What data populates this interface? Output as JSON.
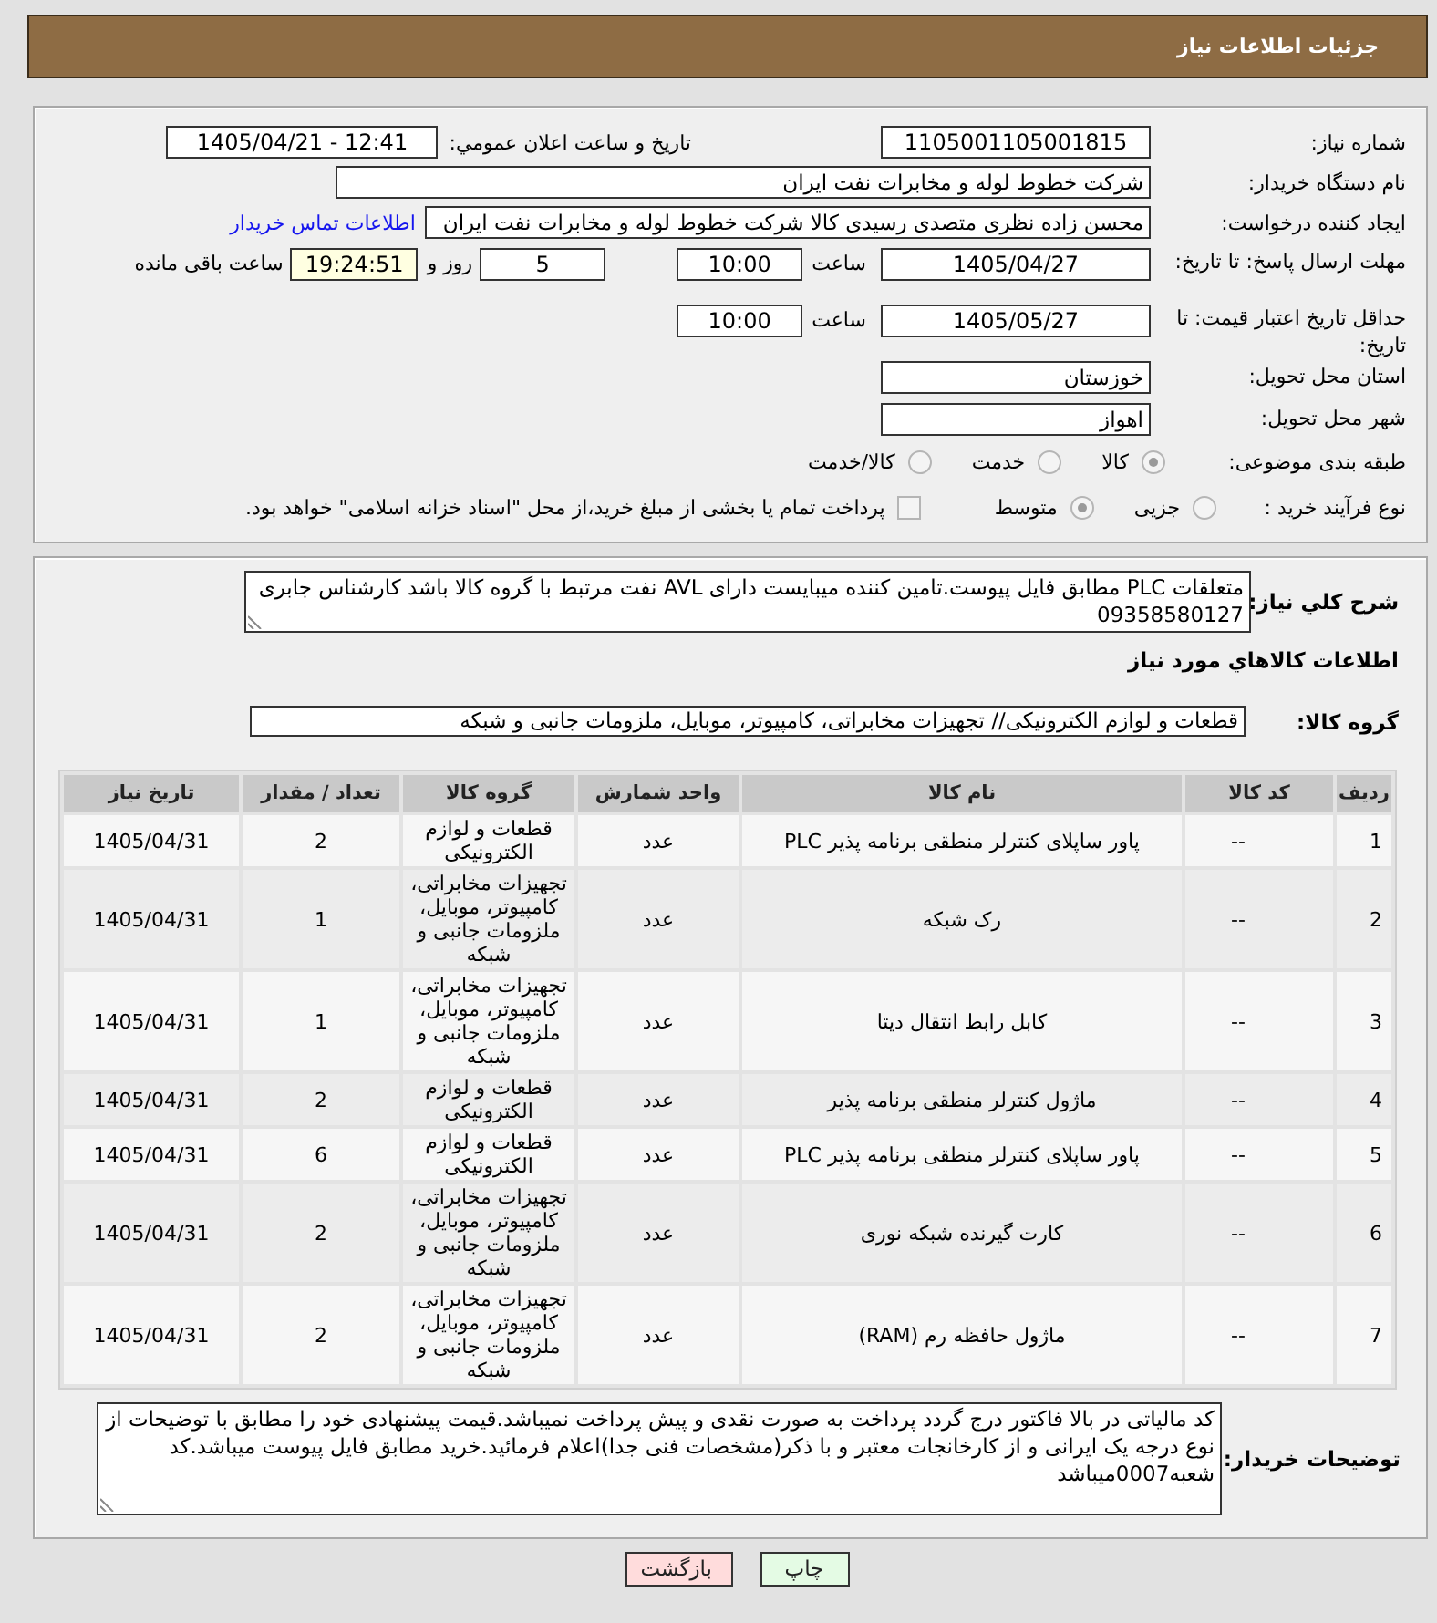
{
  "header": {
    "title": "جزئیات اطلاعات نیاز"
  },
  "details": {
    "need_number": {
      "label": "شماره نیاز:",
      "value": "1105001105001815"
    },
    "announce": {
      "label": "تاریخ و ساعت اعلان عمومي:",
      "value": "1405/04/21 - 12:41"
    },
    "buyer_org": {
      "label": "نام دستگاه خریدار:",
      "value": "شرکت خطوط لوله و مخابرات نفت ایران"
    },
    "creator": {
      "label": "ایجاد کننده درخواست:",
      "value": "محسن زاده نظری متصدی رسیدی کالا شرکت خطوط لوله و مخابرات نفت ایران",
      "link": "اطلاعات تماس خریدار"
    },
    "response_deadline": {
      "label": "مهلت ارسال پاسخ: تا تاریخ:",
      "date": "1405/04/27",
      "time_label": "ساعت",
      "time": "10:00",
      "days": "5",
      "days_label": "روز و",
      "remaining": "19:24:51",
      "remaining_label": "ساعت باقی مانده"
    },
    "price_validity": {
      "label": "حداقل تاریخ اعتبار قیمت: تا تاریخ:",
      "date": "1405/05/27",
      "time_label": "ساعت",
      "time": "10:00"
    },
    "province": {
      "label": "استان محل تحویل:",
      "value": "خوزستان"
    },
    "city": {
      "label": "شهر محل تحویل:",
      "value": "اهواز"
    },
    "category": {
      "label": "طبقه بندی موضوعی:",
      "disabled": true,
      "options": [
        {
          "label": "کالا",
          "selected": true
        },
        {
          "label": "خدمت",
          "selected": false
        },
        {
          "label": "کالا/خدمت",
          "selected": false
        }
      ]
    },
    "purchase_type": {
      "label": "نوع فرآیند خرید :",
      "disabled": true,
      "options": [
        {
          "label": "جزیی",
          "selected": false
        },
        {
          "label": "متوسط",
          "selected": true
        }
      ],
      "treasury": {
        "label": "پرداخت تمام یا بخشی از مبلغ خرید،از محل \"اسناد خزانه اسلامی\" خواهد بود.",
        "checked": false,
        "disabled": true
      }
    }
  },
  "description": {
    "label": "شرح کلي نیاز:",
    "value": "متعلقات PLC مطابق فایل پیوست.تامین کننده میبایست دارای AVL نفت مرتبط با گروه کالا باشد کارشناس جابری 09358580127"
  },
  "goods": {
    "title": "اطلاعات کالاهاي مورد نیاز",
    "group_label": "گروه کالا:",
    "group_value": "قطعات و لوازم الکترونیکی// تجهیزات مخابراتی، کامپیوتر، موبایل، ملزومات جانبی و شبکه",
    "table": {
      "columns": [
        "ردیف",
        "کد کالا",
        "نام کالا",
        "واحد شمارش",
        "گروه کالا",
        "تعداد / مقدار",
        "تاریخ نیاز"
      ],
      "rows": [
        {
          "index": "1",
          "code": "--",
          "name": "پاور ساپلای کنترلر منطقی برنامه پذیر PLC",
          "unit": "عدد",
          "group": "قطعات و لوازم الکترونیکی",
          "quantity": "2",
          "need_date": "1405/04/31"
        },
        {
          "index": "2",
          "code": "--",
          "name": "رک شبکه",
          "unit": "عدد",
          "group": "تجهیزات مخابراتی، کامپیوتر، موبایل، ملزومات جانبی و شبکه",
          "quantity": "1",
          "need_date": "1405/04/31"
        },
        {
          "index": "3",
          "code": "--",
          "name": "کابل رابط انتقال دیتا",
          "unit": "عدد",
          "group": "تجهیزات مخابراتی، کامپیوتر، موبایل، ملزومات جانبی و شبکه",
          "quantity": "1",
          "need_date": "1405/04/31"
        },
        {
          "index": "4",
          "code": "--",
          "name": "ماژول کنترلر منطقی برنامه پذیر",
          "unit": "عدد",
          "group": "قطعات و لوازم الکترونیکی",
          "quantity": "2",
          "need_date": "1405/04/31"
        },
        {
          "index": "5",
          "code": "--",
          "name": "پاور ساپلای کنترلر منطقی برنامه پذیر PLC",
          "unit": "عدد",
          "group": "قطعات و لوازم الکترونیکی",
          "quantity": "6",
          "need_date": "1405/04/31"
        },
        {
          "index": "6",
          "code": "--",
          "name": "کارت گیرنده شبکه نوری",
          "unit": "عدد",
          "group": "تجهیزات مخابراتی، کامپیوتر، موبایل، ملزومات جانبی و شبکه",
          "quantity": "2",
          "need_date": "1405/04/31"
        },
        {
          "index": "7",
          "code": "--",
          "name": "ماژول حافظه رم (RAM)",
          "unit": "عدد",
          "group": "تجهیزات مخابراتی، کامپیوتر، موبایل، ملزومات جانبی و شبکه",
          "quantity": "2",
          "need_date": "1405/04/31"
        }
      ]
    }
  },
  "buyer_notes": {
    "label": "توضیحات خریدار:",
    "value": "کد مالیاتی در بالا فاکتور درج گردد پرداخت به صورت نقدی و پیش پرداخت نمیباشد.قیمت پیشنهادی خود را مطابق با توضیحات از نوع درجه یک ایرانی و از کارخانجات معتبر و با ذکر(مشخصات فنی جدا)اعلام فرمائید.خرید مطابق فایل پیوست میباشد.کد شعبه0007میباشد"
  },
  "buttons": [
    {
      "label": "چاپ",
      "kind": "print"
    },
    {
      "label": "بازگشت",
      "kind": "back"
    }
  ]
}
